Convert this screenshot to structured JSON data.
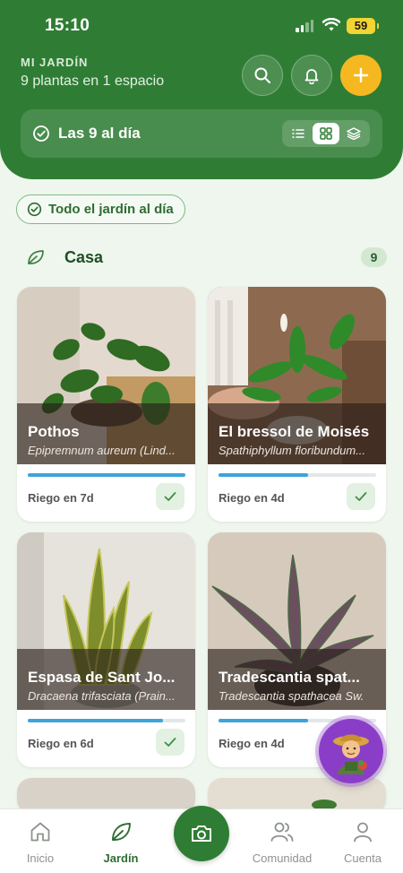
{
  "status_bar": {
    "time": "15:10",
    "battery": "59"
  },
  "header": {
    "garden_label": "MI JARDÍN",
    "garden_summary": "9 plantas en 1 espacio",
    "status_text": "Las 9 al día",
    "view_modes": [
      "list",
      "grid",
      "layers"
    ],
    "active_view": "grid"
  },
  "chip": {
    "label": "Todo el jardín al día"
  },
  "section": {
    "title": "Casa",
    "count": "9"
  },
  "plants": [
    {
      "name": "Pothos",
      "scientific": "Epipremnum aureum (Lind...",
      "watering": "Riego en 7d",
      "progress": 1.0
    },
    {
      "name": "El bressol de Moisés",
      "scientific": "Spathiphyllum floribundum...",
      "watering": "Riego en 4d",
      "progress": 0.57
    },
    {
      "name": "Espasa de Sant Jo...",
      "scientific": "Dracaena trifasciata (Prain...",
      "watering": "Riego en 6d",
      "progress": 0.86
    },
    {
      "name": "Tradescantia spat...",
      "scientific": "Tradescantia spathacea Sw.",
      "watering": "Riego en 4d",
      "progress": 0.57
    }
  ],
  "nav": {
    "items": [
      {
        "label": "Inicio",
        "icon": "home-icon"
      },
      {
        "label": "Jardín",
        "icon": "leaf-icon"
      },
      {
        "label": "",
        "icon": "camera-icon"
      },
      {
        "label": "Comunidad",
        "icon": "people-icon"
      },
      {
        "label": "Cuenta",
        "icon": "user-icon"
      }
    ],
    "active": "Jardín"
  },
  "colors": {
    "primary": "#2f7d34",
    "accent": "#f5b820",
    "progress": "#3ca4d9",
    "assistant": "#8a3ec7"
  }
}
